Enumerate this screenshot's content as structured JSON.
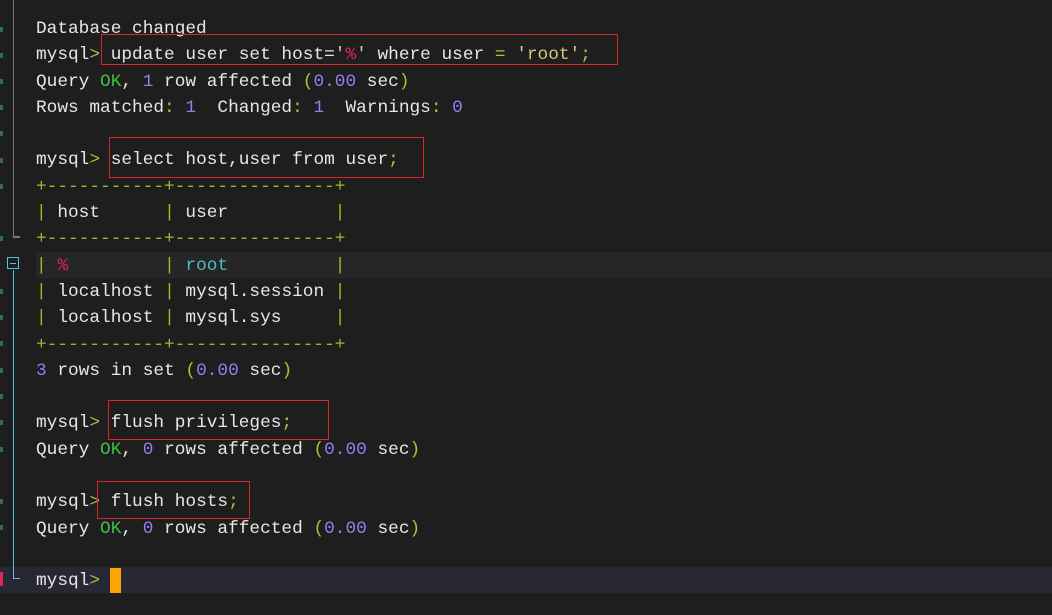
{
  "terminal": {
    "prompt": "mysql",
    "prompt_arrow": ">",
    "lines": [
      {
        "kind": "output",
        "text": "Database changed"
      },
      {
        "kind": "command",
        "parts": [
          {
            "t": "update user set host=",
            "c": "w"
          },
          {
            "t": "'",
            "c": "s"
          },
          {
            "t": "%",
            "c": "p"
          },
          {
            "t": "'",
            "c": "s"
          },
          {
            "t": " where user ",
            "c": "w"
          },
          {
            "t": "=",
            "c": "y"
          },
          {
            "t": " 'root'",
            "c": "s"
          },
          {
            "t": ";",
            "c": "y"
          }
        ]
      },
      {
        "kind": "output",
        "parts": [
          {
            "t": "Query ",
            "c": "w"
          },
          {
            "t": "OK",
            "c": "g"
          },
          {
            "t": ", ",
            "c": "w"
          },
          {
            "t": "1",
            "c": "n"
          },
          {
            "t": " row affected ",
            "c": "w"
          },
          {
            "t": "(",
            "c": "y"
          },
          {
            "t": "0.00",
            "c": "n"
          },
          {
            "t": " sec",
            "c": "w"
          },
          {
            "t": ")",
            "c": "y"
          }
        ]
      },
      {
        "kind": "output",
        "parts": [
          {
            "t": "Rows matched",
            "c": "w"
          },
          {
            "t": ":",
            "c": "y"
          },
          {
            "t": " 1",
            "c": "n"
          },
          {
            "t": "  Changed",
            "c": "w"
          },
          {
            "t": ":",
            "c": "y"
          },
          {
            "t": " 1",
            "c": "n"
          },
          {
            "t": "  Warnings",
            "c": "w"
          },
          {
            "t": ":",
            "c": "y"
          },
          {
            "t": " 0",
            "c": "n"
          }
        ]
      },
      {
        "kind": "blank"
      },
      {
        "kind": "command",
        "parts": [
          {
            "t": "select host,user from user",
            "c": "w"
          },
          {
            "t": ";",
            "c": "y"
          }
        ]
      },
      {
        "kind": "output",
        "parts": [
          {
            "t": "+-----------+---------------+",
            "c": "b"
          }
        ]
      },
      {
        "kind": "output",
        "parts": [
          {
            "t": "|",
            "c": "b"
          },
          {
            "t": " host      ",
            "c": "w"
          },
          {
            "t": "|",
            "c": "b"
          },
          {
            "t": " user          ",
            "c": "w"
          },
          {
            "t": "|",
            "c": "b"
          }
        ]
      },
      {
        "kind": "output",
        "parts": [
          {
            "t": "+-----------+---------------+",
            "c": "b"
          }
        ]
      },
      {
        "kind": "output",
        "parts": [
          {
            "t": "|",
            "c": "b"
          },
          {
            "t": " %         ",
            "c": "p"
          },
          {
            "t": "|",
            "c": "b"
          },
          {
            "t": " root          ",
            "c": "c"
          },
          {
            "t": "|",
            "c": "b"
          }
        ]
      },
      {
        "kind": "output",
        "parts": [
          {
            "t": "|",
            "c": "b"
          },
          {
            "t": " localhost ",
            "c": "w"
          },
          {
            "t": "|",
            "c": "b"
          },
          {
            "t": " mysql.session ",
            "c": "w"
          },
          {
            "t": "|",
            "c": "b"
          }
        ]
      },
      {
        "kind": "output",
        "parts": [
          {
            "t": "|",
            "c": "b"
          },
          {
            "t": " localhost ",
            "c": "w"
          },
          {
            "t": "|",
            "c": "b"
          },
          {
            "t": " mysql.sys     ",
            "c": "w"
          },
          {
            "t": "|",
            "c": "b"
          }
        ]
      },
      {
        "kind": "output",
        "parts": [
          {
            "t": "+-----------+---------------+",
            "c": "b"
          }
        ]
      },
      {
        "kind": "output",
        "parts": [
          {
            "t": "3",
            "c": "n"
          },
          {
            "t": " rows in set ",
            "c": "w"
          },
          {
            "t": "(",
            "c": "y"
          },
          {
            "t": "0.00",
            "c": "n"
          },
          {
            "t": " sec",
            "c": "w"
          },
          {
            "t": ")",
            "c": "y"
          }
        ]
      },
      {
        "kind": "blank"
      },
      {
        "kind": "command",
        "parts": [
          {
            "t": "flush privileges",
            "c": "w"
          },
          {
            "t": ";",
            "c": "y"
          }
        ]
      },
      {
        "kind": "output",
        "parts": [
          {
            "t": "Query ",
            "c": "w"
          },
          {
            "t": "OK",
            "c": "g"
          },
          {
            "t": ", ",
            "c": "w"
          },
          {
            "t": "0",
            "c": "n"
          },
          {
            "t": " rows affected ",
            "c": "w"
          },
          {
            "t": "(",
            "c": "y"
          },
          {
            "t": "0.00",
            "c": "n"
          },
          {
            "t": " sec",
            "c": "w"
          },
          {
            "t": ")",
            "c": "y"
          }
        ]
      },
      {
        "kind": "blank"
      },
      {
        "kind": "command",
        "parts": [
          {
            "t": "flush hosts",
            "c": "w"
          },
          {
            "t": ";",
            "c": "y"
          }
        ]
      },
      {
        "kind": "output",
        "parts": [
          {
            "t": "Query ",
            "c": "w"
          },
          {
            "t": "OK",
            "c": "g"
          },
          {
            "t": ", ",
            "c": "w"
          },
          {
            "t": "0",
            "c": "n"
          },
          {
            "t": " rows affected ",
            "c": "w"
          },
          {
            "t": "(",
            "c": "y"
          },
          {
            "t": "0.00",
            "c": "n"
          },
          {
            "t": " sec",
            "c": "w"
          },
          {
            "t": ")",
            "c": "y"
          }
        ]
      },
      {
        "kind": "blank"
      },
      {
        "kind": "command",
        "parts": []
      }
    ],
    "query_result": {
      "columns": [
        "host",
        "user"
      ],
      "rows": [
        [
          "%",
          "root"
        ],
        [
          "localhost",
          "mysql.session"
        ],
        [
          "localhost",
          "mysql.sys"
        ]
      ],
      "summary": "3 rows in set (0.00 sec)"
    }
  },
  "colors": {
    "background": "#1e1e1e",
    "annotation_box": "#d9262c",
    "cursor": "#ffa500",
    "ok": "#3fbf3f",
    "number": "#9a7cf0",
    "punct": "#a7c43a",
    "wildcard": "#e0245e"
  }
}
